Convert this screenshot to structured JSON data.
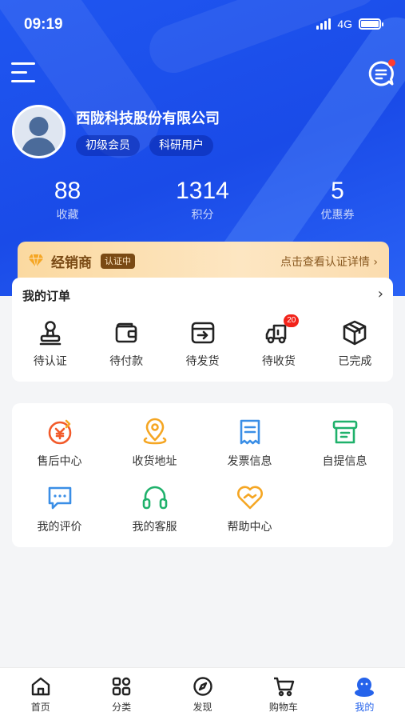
{
  "status": {
    "time": "09:19",
    "network": "4G"
  },
  "profile": {
    "company": "西陇科技股份有限公司",
    "tags": [
      "初级会员",
      "科研用户"
    ]
  },
  "stats": [
    {
      "value": "88",
      "label": "收藏"
    },
    {
      "value": "1314",
      "label": "积分"
    },
    {
      "value": "5",
      "label": "优惠券"
    }
  ],
  "dealer": {
    "title": "经销商",
    "badge": "认证中",
    "link": "点击查看认证详情 ›"
  },
  "orders": {
    "title": "我的订单",
    "chevron": "›",
    "items": [
      {
        "label": "待认证",
        "icon": "stamp-icon"
      },
      {
        "label": "待付款",
        "icon": "wallet-icon"
      },
      {
        "label": "待发货",
        "icon": "box-out-icon"
      },
      {
        "label": "待收货",
        "icon": "truck-icon",
        "count": "20"
      },
      {
        "label": "已完成",
        "icon": "package-icon"
      }
    ]
  },
  "services": [
    {
      "label": "售后中心",
      "icon": "after-sales-icon",
      "color": "#f25a2a"
    },
    {
      "label": "收货地址",
      "icon": "location-icon",
      "color": "#f5a623"
    },
    {
      "label": "发票信息",
      "icon": "invoice-icon",
      "color": "#3a8ee6"
    },
    {
      "label": "自提信息",
      "icon": "pickup-icon",
      "color": "#1fb16b"
    },
    {
      "label": "我的评价",
      "icon": "comment-icon",
      "color": "#3a8ee6"
    },
    {
      "label": "我的客服",
      "icon": "headset-icon",
      "color": "#1fb16b"
    },
    {
      "label": "帮助中心",
      "icon": "help-heart-icon",
      "color": "#f5a623"
    }
  ],
  "tabbar": [
    {
      "label": "首页",
      "icon": "home-icon"
    },
    {
      "label": "分类",
      "icon": "category-icon"
    },
    {
      "label": "发现",
      "icon": "compass-icon"
    },
    {
      "label": "购物车",
      "icon": "cart-icon"
    },
    {
      "label": "我的",
      "icon": "profile-icon",
      "active": true
    }
  ],
  "colors": {
    "primary": "#1f56f0",
    "active_tab": "#2563eb",
    "badge_red": "#f2231a",
    "dealer_brown": "#7a4a14"
  }
}
